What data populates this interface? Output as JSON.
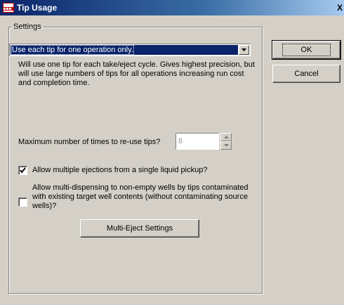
{
  "window": {
    "title": "Tip Usage",
    "close_label": "X"
  },
  "settings": {
    "group_label": "Settings",
    "mode_select": {
      "selected": "Use each tip for one operation only."
    },
    "description": "Will use one tip for each take/eject cycle. Gives highest precision, but will use large numbers of tips for all operations increasing run cost and completion time.",
    "max_reuse": {
      "label": "Maximum number of times to re-use tips?",
      "value": "8",
      "disabled": true
    },
    "allow_multiple_ejections": {
      "label": "Allow multiple ejections from a single liquid pickup?",
      "checked": true
    },
    "allow_multi_dispensing": {
      "label": "Allow multi-dispensing to non-empty wells by tips contaminated with existing target well contents (without contaminating source wells)?",
      "checked": false
    },
    "multi_eject_button": "Multi-Eject Settings"
  },
  "actions": {
    "ok": "OK",
    "cancel": "Cancel"
  }
}
